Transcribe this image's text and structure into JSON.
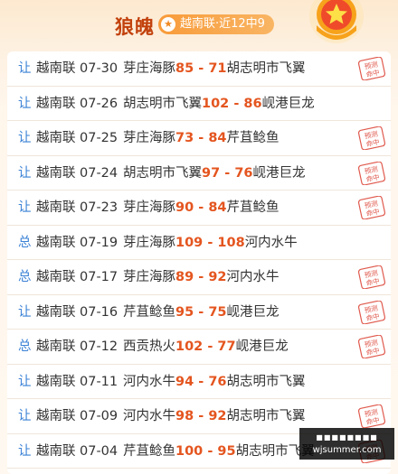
{
  "header": {
    "title": "狼魄",
    "record_badge": "越南联·近12中9",
    "badge_icon": "star-icon",
    "medal_icon": "star-medal-icon"
  },
  "colors": {
    "accent_orange": "#e4551f",
    "tag_blue": "#3b82d6",
    "title_brown": "#c2410c",
    "stamp_red": "#e05a4e"
  },
  "stamp_label": "预测命中",
  "rows": [
    {
      "tag": "让",
      "league": "越南联",
      "date": "07-30",
      "home": "芽庄海豚",
      "home_score": "85",
      "sep": " - ",
      "away_score": "71",
      "away": "胡志明市飞翼",
      "hit": true
    },
    {
      "tag": "让",
      "league": "越南联",
      "date": "07-26",
      "home": "胡志明市飞翼",
      "home_score": "102",
      "sep": " - ",
      "away_score": "86",
      "away": "岘港巨龙",
      "hit": false
    },
    {
      "tag": "让",
      "league": "越南联",
      "date": "07-25",
      "home": "芽庄海豚",
      "home_score": "73",
      "sep": " - ",
      "away_score": "84",
      "away": "芹苴鲶鱼",
      "hit": true
    },
    {
      "tag": "让",
      "league": "越南联",
      "date": "07-24",
      "home": "胡志明市飞翼",
      "home_score": "97",
      "sep": " - ",
      "away_score": "76",
      "away": "岘港巨龙",
      "hit": true
    },
    {
      "tag": "让",
      "league": "越南联",
      "date": "07-23",
      "home": "芽庄海豚",
      "home_score": "90",
      "sep": " - ",
      "away_score": "84",
      "away": "芹苴鲶鱼",
      "hit": true
    },
    {
      "tag": "总",
      "league": "越南联",
      "date": "07-19",
      "home": "芽庄海豚",
      "home_score": "109",
      "sep": " - ",
      "away_score": "108",
      "away": "河内水牛",
      "hit": false
    },
    {
      "tag": "总",
      "league": "越南联",
      "date": "07-17",
      "home": "芽庄海豚",
      "home_score": "89",
      "sep": " - ",
      "away_score": "92",
      "away": "河内水牛",
      "hit": true
    },
    {
      "tag": "让",
      "league": "越南联",
      "date": "07-16",
      "home": "芹苴鲶鱼",
      "home_score": "95",
      "sep": " - ",
      "away_score": "75",
      "away": "岘港巨龙",
      "hit": true
    },
    {
      "tag": "总",
      "league": "越南联",
      "date": "07-12",
      "home": "西贡热火",
      "home_score": "102",
      "sep": " - ",
      "away_score": "77",
      "away": "岘港巨龙",
      "hit": true
    },
    {
      "tag": "让",
      "league": "越南联",
      "date": "07-11",
      "home": "河内水牛",
      "home_score": "94",
      "sep": " - ",
      "away_score": "76",
      "away": "胡志明市飞翼",
      "hit": false
    },
    {
      "tag": "让",
      "league": "越南联",
      "date": "07-09",
      "home": "河内水牛",
      "home_score": "98",
      "sep": " - ",
      "away_score": "92",
      "away": "胡志明市飞翼",
      "hit": true
    },
    {
      "tag": "让",
      "league": "越南联",
      "date": "07-04",
      "home": "芹苴鲶鱼",
      "home_score": "100",
      "sep": " - ",
      "away_score": "95",
      "away": "胡志明市飞翼",
      "hit": true
    }
  ],
  "watermark": {
    "top": "■■■■■■■■",
    "bottom": "wjsummer.com"
  }
}
